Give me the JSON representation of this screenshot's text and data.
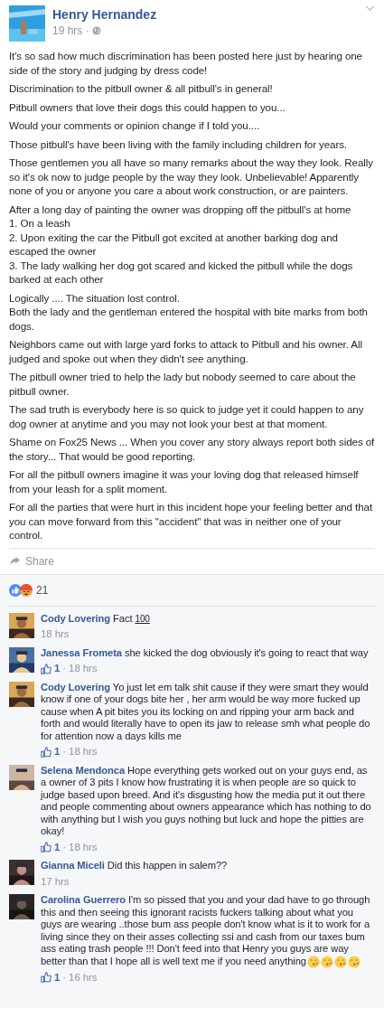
{
  "post": {
    "author": "Henry Hernandez",
    "time": "19 hrs ·",
    "paragraphs": [
      {
        "lines": [
          "It's so sad how much discrimination has been posted here just by hearing one side of the story and judging by dress code!"
        ]
      },
      {
        "lines": [
          "Discrimination to the pitbull owner & all pitbull's in general!"
        ]
      },
      {
        "lines": [
          "Pitbull owners that love their dogs this could happen to you..."
        ]
      },
      {
        "lines": [
          "Would your comments or opinion change if I told you...."
        ]
      },
      {
        "lines": [
          "Those pitbull's have been living with the family including children for years."
        ]
      },
      {
        "lines": [
          "Those gentlemen you all have so many remarks about the way they look. Really so it's ok now to judge people by the way they look. Unbelievable! Apparently none of you or anyone you care a about work construction, or are painters."
        ]
      },
      {
        "lines": [
          "After a long day of painting the owner was dropping off the pitbull's at home",
          "1. On a leash",
          "2. Upon exiting the car the Pitbull got excited at another barking dog and escaped the owner",
          "3. The lady walking her dog got scared and kicked the pitbull while the dogs barked at each other"
        ]
      },
      {
        "lines": [
          "Logically .... The situation lost control.",
          "Both the lady and the gentleman entered the hospital with bite marks from both dogs."
        ]
      },
      {
        "lines": [
          "Neighbors came out with large yard forks to attack to Pitbull and his owner. All judged and spoke out when they didn't see anything."
        ]
      },
      {
        "lines": [
          "The pitbull owner tried to help the lady but nobody seemed to care about the pitbull owner."
        ]
      },
      {
        "lines": [
          "The sad truth is everybody here is so quick to judge yet it could happen to any dog owner at anytime and you may not look your best at that moment."
        ]
      },
      {
        "lines": [
          "Shame on Fox25 News ... When you cover any story always report both sides of the story... That would be good reporting."
        ]
      },
      {
        "lines": [
          "For all the pitbull owners imagine it was your loving dog that released himself from your leash for a split moment."
        ]
      },
      {
        "lines": [
          "For all the parties that were hurt in this incident hope your feeling better and that you can move forward from this \"accident\" that was in neither one of your control."
        ]
      }
    ],
    "share": "Share",
    "reaction_count": "21"
  },
  "comments": [
    {
      "author": "Cody Lovering",
      "text": "Fact",
      "badge": "100",
      "time": "18 hrs"
    },
    {
      "author": "Janessa Frometa",
      "text": "she kicked the dog obviously it's going to react that way",
      "likes": "1",
      "time": "· 18 hrs"
    },
    {
      "author": "Cody Lovering",
      "text": "Yo just let em talk shit cause if they were smart they would know if one of your dogs bite her , her arm would be way more fucked up cause when A pit bites you its locking on and ripping your arm back and forth and would literally have to open its jaw to release smh what people do for attention now a days kills me",
      "likes": "1",
      "time": "· 18 hrs"
    },
    {
      "author": "Selena Mendonca",
      "text": "Hope everything gets worked out on your guys end, as a owner of 3 pits I know how frustrating it is when people are so quick to judge based upon breed. And it's disgusting how the media put it out there and people commenting about owners appearance which has nothing to do with anything but I wish you guys nothing but luck and hope the pitties are okay!",
      "likes": "1",
      "time": "· 18 hrs"
    },
    {
      "author": "Gianna Miceli",
      "text": "Did this happen in salem??",
      "time": "17 hrs"
    },
    {
      "author": "Carolina Guerrero",
      "text": "I'm so pissed that you and your dad have to go through this and then seeing this ignorant racists fuckers talking about what you guys are wearing ..those bum ass people don't know what is it to work for a living since they on their asses collecting ssi and cash from our taxes bum ass eating trash people !!! Don't feed into that Henry you guys are way better than that I hope all is well text me if you need anything",
      "emojis": [
        {
          "kind": "kissing-face"
        },
        {
          "kind": "kissing-face"
        },
        {
          "kind": "kissing-face"
        },
        {
          "kind": "kissing-face"
        }
      ],
      "likes": "1",
      "time": "· 16 hrs"
    }
  ]
}
